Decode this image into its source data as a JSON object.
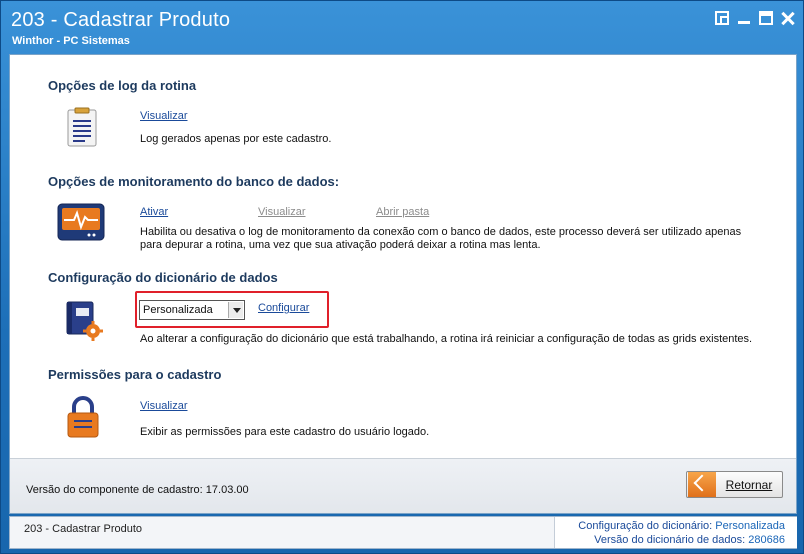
{
  "window": {
    "title": "203 - Cadastrar  Produto",
    "subtitle": "Winthor - PC Sistemas"
  },
  "sections": {
    "log": {
      "title": "Opções de log da rotina",
      "link_visualizar": "Visualizar",
      "description": "Log gerados apenas por este cadastro."
    },
    "monitor": {
      "title": "Opções de monitoramento do banco de dados:",
      "link_ativar": "Ativar",
      "link_visualizar": "Visualizar",
      "link_abrir_pasta": "Abrir pasta",
      "description_line1": "Habilita ou desativa o log de monitoramento da conexão com o banco de dados, este processo deverá ser utilizado apenas",
      "description_line2": "para depurar a rotina, uma vez que sua ativação poderá deixar a rotina mas lenta."
    },
    "dicionario": {
      "title": "Configuração do dicionário de dados",
      "select_value": "Personalizada",
      "link_configurar": "Configurar",
      "description": "Ao alterar a configuração do dicionário que está trabalhando, a rotina irá reiniciar a configuração de todas as grids existentes."
    },
    "permissoes": {
      "title": "Permissões para o cadastro",
      "link_visualizar": "Visualizar",
      "description": "Exibir as permissões para este cadastro do usuário logado."
    }
  },
  "footer": {
    "version_label": "Versão do componente de cadastro: 17.03.00",
    "retornar_label": "Retornar"
  },
  "statusbar": {
    "left": "203 - Cadastrar  Produto",
    "config_key": "Configuração do dicionário:",
    "config_value": "Personalizada",
    "version_key": "Versão do dicionário de dados:",
    "version_value": "280686"
  }
}
